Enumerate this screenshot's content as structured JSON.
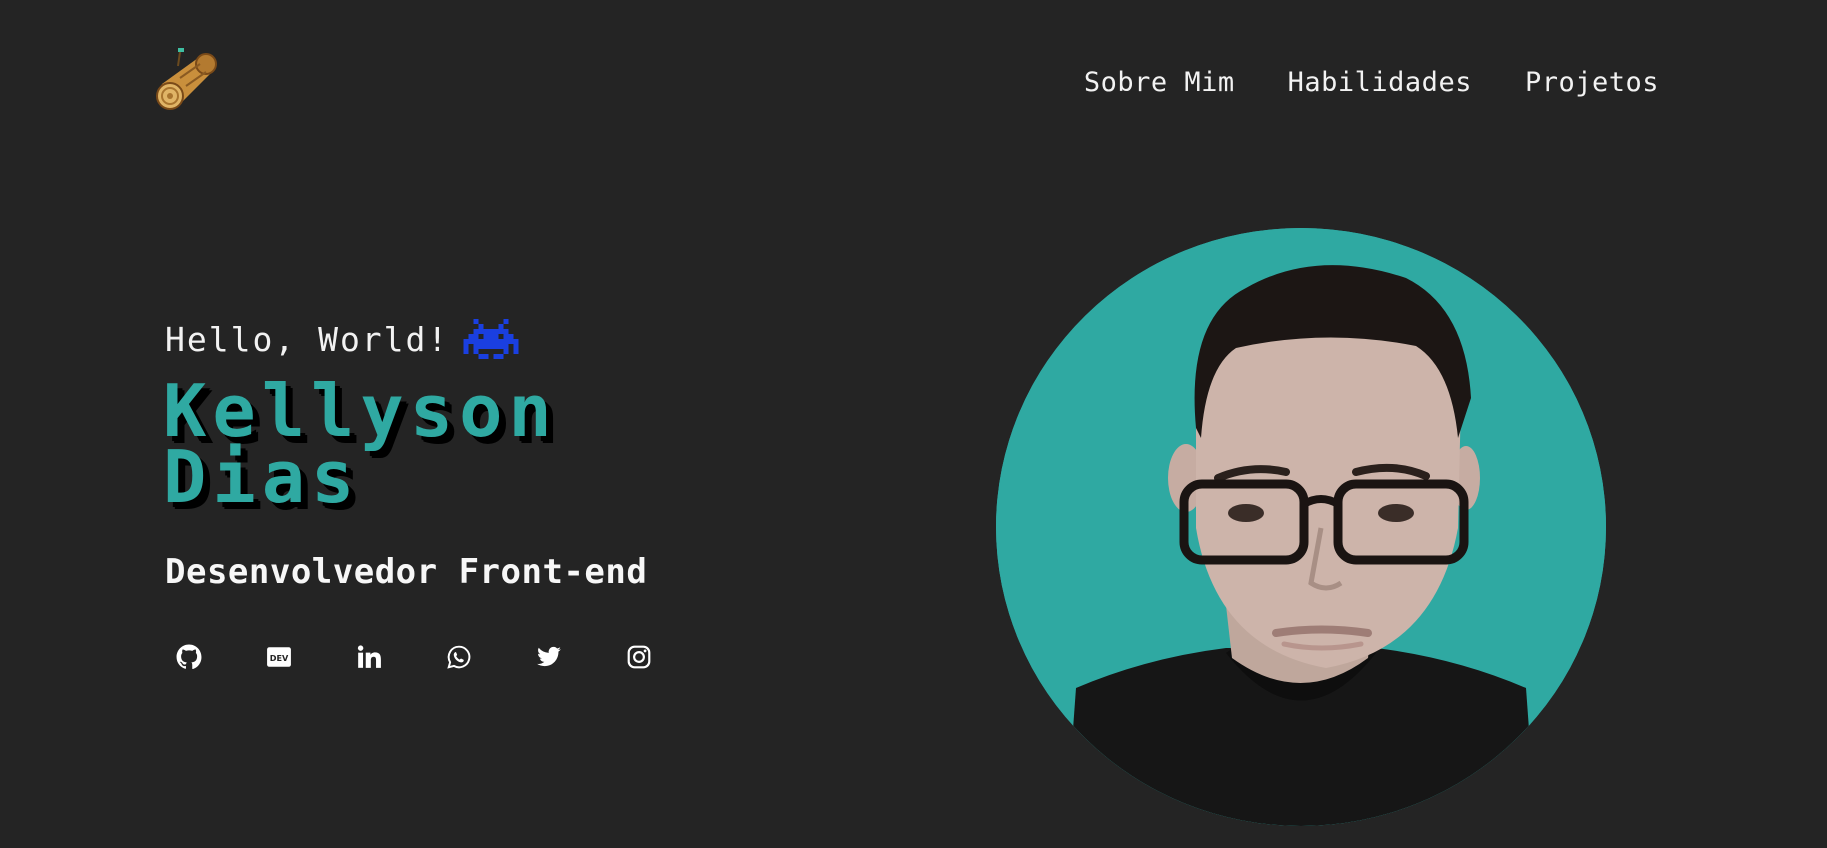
{
  "header": {
    "logo_icon": "wooden-log-icon",
    "nav": [
      {
        "label": "Sobre Mim"
      },
      {
        "label": "Habilidades"
      },
      {
        "label": "Projetos"
      }
    ]
  },
  "hero": {
    "greeting": "Hello, World!",
    "greeting_icon": "space-invader-icon",
    "name_line1": "Kellyson",
    "name_line2": "Dias",
    "role": "Desenvolvedor Front-end",
    "socials": [
      {
        "icon": "github-icon"
      },
      {
        "icon": "dev-to-icon"
      },
      {
        "icon": "linkedin-icon"
      },
      {
        "icon": "whatsapp-icon"
      },
      {
        "icon": "twitter-icon"
      },
      {
        "icon": "instagram-icon"
      }
    ],
    "avatar_icon": "profile-photo"
  },
  "colors": {
    "background": "#242424",
    "accent": "#2fa9a2",
    "invader": "#1a3fe0",
    "text": "#f2f2f2"
  }
}
